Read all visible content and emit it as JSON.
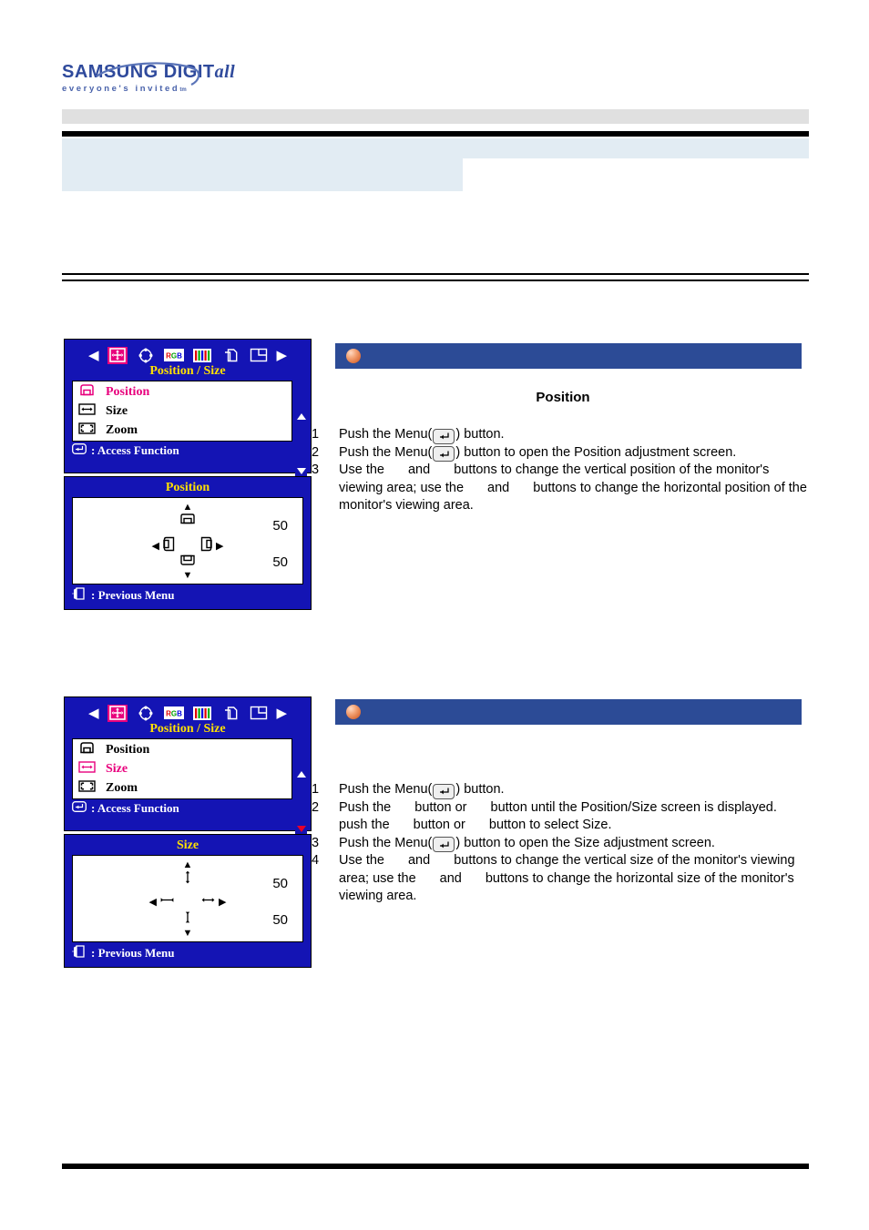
{
  "logo": {
    "brand": "SAMSUNG DIGIT",
    "brand_italic": "all",
    "tagline": "everyone's invited",
    "tagline_tm": "tm"
  },
  "osd_icons": {
    "left_arrow": "left-arrow",
    "right_arrow": "right-arrow",
    "items": [
      "position-size-icon",
      "geometry-icon",
      "rgb-icon",
      "color-bars-icon",
      "pages-icon",
      "pip-layout-icon"
    ]
  },
  "sections": [
    {
      "menu": {
        "title": "Position / Size",
        "items": [
          {
            "label": "Position",
            "icon": "position-icon",
            "active": true
          },
          {
            "label": "Size",
            "icon": "size-icon",
            "active": false
          },
          {
            "label": "Zoom",
            "icon": "zoom-icon",
            "active": false
          }
        ],
        "footer": ": Access Function",
        "scroll_up": "scroll-up-triangle",
        "scroll_down": "scroll-down-triangle",
        "scroll_down_highlight": false
      },
      "adjust": {
        "title": "Position",
        "value_top": "50",
        "value_bottom": "50",
        "footer": ": Previous Menu",
        "up_icon": "move-up-icon",
        "down_icon": "move-down-icon",
        "left_icon": "move-left-icon",
        "right_icon": "move-right-icon"
      },
      "heading": "Position",
      "steps": [
        {
          "num": "1",
          "parts": [
            {
              "t": "Push the Menu("
            },
            {
              "chip": "enter-key"
            },
            {
              "t": ") button."
            }
          ]
        },
        {
          "num": "2",
          "parts": [
            {
              "t": "Push the Menu("
            },
            {
              "chip": "enter-key"
            },
            {
              "t": ") button to open the Position adjustment screen."
            }
          ]
        },
        {
          "num": "3",
          "parts": [
            {
              "t": "Use the"
            },
            {
              "gap": true
            },
            {
              "t": "and"
            },
            {
              "gap": true
            },
            {
              "t": "buttons to change the vertical position of the monitor's viewing area; use the"
            },
            {
              "gap": true
            },
            {
              "t": "and"
            },
            {
              "gap": true
            },
            {
              "t": "buttons to change the horizontal position of the monitor's viewing area."
            }
          ]
        }
      ]
    },
    {
      "menu": {
        "title": "Position / Size",
        "items": [
          {
            "label": "Position",
            "icon": "position-icon",
            "active": false
          },
          {
            "label": "Size",
            "icon": "size-icon",
            "active": true
          },
          {
            "label": "Zoom",
            "icon": "zoom-icon",
            "active": false
          }
        ],
        "footer": ": Access Function",
        "scroll_up": "scroll-up-triangle",
        "scroll_down": "scroll-down-triangle",
        "scroll_down_highlight": true
      },
      "adjust": {
        "title": "Size",
        "value_top": "50",
        "value_bottom": "50",
        "footer": ": Previous Menu",
        "up_icon": "size-up-icon",
        "down_icon": "size-down-icon",
        "left_icon": "size-narrow-icon",
        "right_icon": "size-wide-icon"
      },
      "heading": "",
      "steps": [
        {
          "num": "1",
          "parts": [
            {
              "t": "Push the Menu("
            },
            {
              "chip": "enter-key"
            },
            {
              "t": ") button."
            }
          ]
        },
        {
          "num": "2",
          "parts": [
            {
              "t": "Push the"
            },
            {
              "gap": true
            },
            {
              "t": "button or"
            },
            {
              "gap": true
            },
            {
              "t": "button until the Position/Size screen is displayed. push the"
            },
            {
              "gap": true
            },
            {
              "t": "button or"
            },
            {
              "gap": true
            },
            {
              "t": "button to select Size."
            }
          ]
        },
        {
          "num": "3",
          "parts": [
            {
              "t": "Push the Menu("
            },
            {
              "chip": "enter-key"
            },
            {
              "t": ") button to open the Size adjustment screen."
            }
          ]
        },
        {
          "num": "4",
          "parts": [
            {
              "t": "Use the"
            },
            {
              "gap": true
            },
            {
              "t": "and"
            },
            {
              "gap": true
            },
            {
              "t": "buttons to change the vertical size of the monitor's viewing area; use the"
            },
            {
              "gap": true
            },
            {
              "t": "and"
            },
            {
              "gap": true
            },
            {
              "t": "buttons to change the horizontal size of the monitor's viewing area."
            }
          ]
        }
      ]
    }
  ],
  "colors": {
    "osd_blue": "#1414b4",
    "osd_title_yellow": "#ffe000",
    "osd_highlight_pink": "#e8007d",
    "bar_blue": "#2c4b96",
    "band_blue": "#e2ecf3",
    "band_grey": "#e0e0e0",
    "logo_blue": "#2f4a9c"
  }
}
